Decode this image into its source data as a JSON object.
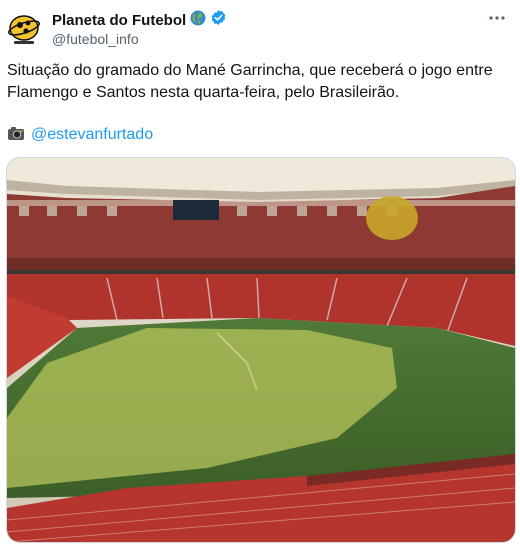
{
  "author": {
    "name": "Planeta do Futebol",
    "handle": "@futebol_info",
    "avatar_icon": "planeta-do-futebol-logo",
    "emoji_icon": "globe-americas-icon",
    "verified_icon": "verified-badge-icon"
  },
  "menu": {
    "more_label": "···"
  },
  "tweet": {
    "text": "Situação do gramado do Mané Garrincha, que receberá o jogo entre Flamengo e Santos nesta quarta-feira, pelo Brasileirão.",
    "credit_icon": "camera-icon",
    "credit_link": "@estevanfurtado"
  },
  "media": {
    "description_icon": "stadium-photo"
  },
  "colors": {
    "link": "#1d9bf0",
    "verified": "#1d9bf0",
    "text": "#0f1419",
    "muted": "#536471"
  }
}
